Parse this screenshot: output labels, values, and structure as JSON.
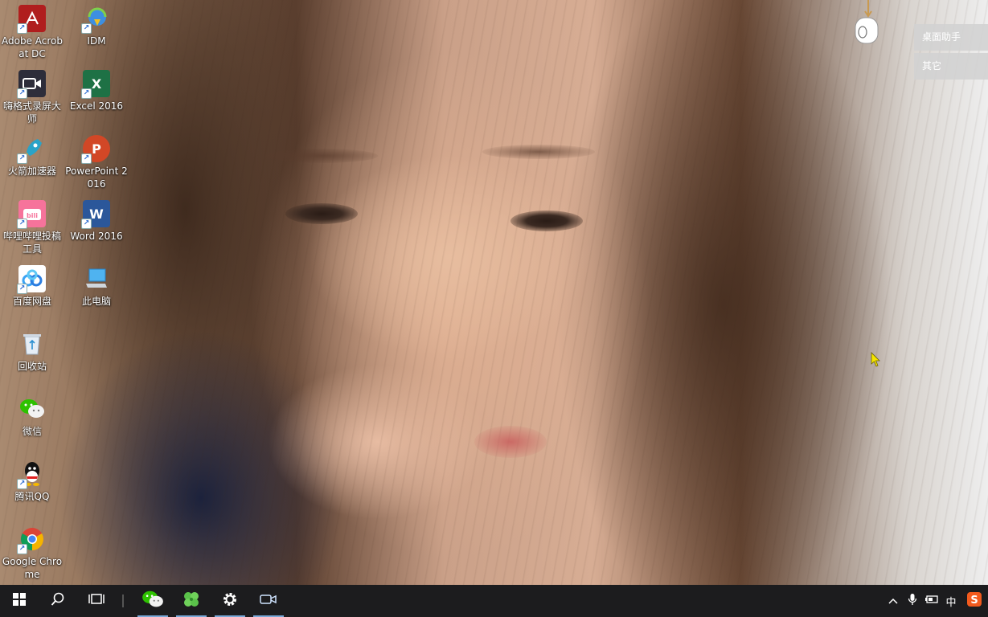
{
  "desktop": {
    "icons": [
      {
        "label": "Adobe Acrobat DC",
        "icon": "acrobat-icon"
      },
      {
        "label": "IDM",
        "icon": "idm-icon"
      },
      {
        "label": "嗨格式录屏大师",
        "icon": "screen-recorder-icon"
      },
      {
        "label": "Excel 2016",
        "icon": "excel-icon"
      },
      {
        "label": "火箭加速器",
        "icon": "rocket-accelerator-icon"
      },
      {
        "label": "PowerPoint 2016",
        "icon": "powerpoint-icon"
      },
      {
        "label": "哔哩哔哩投稿工具",
        "icon": "bilibili-upload-icon"
      },
      {
        "label": "Word 2016",
        "icon": "word-icon"
      },
      {
        "label": "百度网盘",
        "icon": "baidu-netdisk-icon"
      },
      {
        "label": "此电脑",
        "icon": "this-pc-icon"
      },
      {
        "label": "回收站",
        "icon": "recycle-bin-icon"
      },
      {
        "label": "微信",
        "icon": "wechat-icon"
      },
      {
        "label": "腾讯QQ",
        "icon": "qq-icon"
      },
      {
        "label": "Google Chrome",
        "icon": "chrome-icon"
      }
    ]
  },
  "side_panel": {
    "btn1": "桌面助手",
    "btn2": "其它"
  },
  "taskbar": {
    "start": "windows-start-icon",
    "search": "search-icon",
    "task_view": "task-view-icon",
    "pinned": [
      "wechat-icon",
      "clover-icon",
      "settings-gear-icon",
      "video-camera-icon"
    ],
    "tray": {
      "chevron": "chevron-up-icon",
      "mic": "microphone-icon",
      "battery": "battery-icon",
      "ime_label": "中",
      "sogou": "sogou-ime-icon"
    }
  },
  "colors": {
    "taskbar_bg": "#1c1c1e",
    "pinned_indicator": "#7aa9d8",
    "cursor": "#f5e400"
  }
}
